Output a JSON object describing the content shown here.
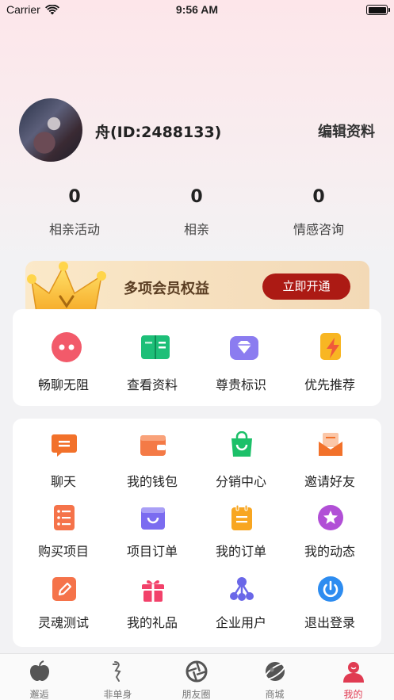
{
  "status_bar": {
    "carrier": "Carrier",
    "time": "9:56 AM"
  },
  "profile": {
    "username": "舟(ID:2488133)",
    "edit_label": "编辑资料"
  },
  "stats": [
    {
      "value": "0",
      "label": "相亲活动"
    },
    {
      "value": "0",
      "label": "相亲"
    },
    {
      "value": "0",
      "label": "情感咨询"
    }
  ],
  "vip": {
    "title": "多项会员权益",
    "button": "立即开通"
  },
  "benefits": [
    {
      "label": "畅聊无阻",
      "icon": "chat-bubble-icon"
    },
    {
      "label": "查看资料",
      "icon": "open-book-icon"
    },
    {
      "label": "尊贵标识",
      "icon": "diamond-icon"
    },
    {
      "label": "优先推荐",
      "icon": "lightning-icon"
    }
  ],
  "menu": [
    {
      "label": "聊天",
      "icon": "chat-icon"
    },
    {
      "label": "我的钱包",
      "icon": "wallet-icon"
    },
    {
      "label": "分销中心",
      "icon": "shopping-bag-icon"
    },
    {
      "label": "邀请好友",
      "icon": "invite-mail-icon"
    },
    {
      "label": "购买项目",
      "icon": "list-icon"
    },
    {
      "label": "项目订单",
      "icon": "basket-icon"
    },
    {
      "label": "我的订单",
      "icon": "clipboard-icon"
    },
    {
      "label": "我的动态",
      "icon": "star-icon"
    },
    {
      "label": "灵魂测试",
      "icon": "pencil-icon"
    },
    {
      "label": "我的礼品",
      "icon": "gift-icon"
    },
    {
      "label": "企业用户",
      "icon": "org-icon"
    },
    {
      "label": "退出登录",
      "icon": "power-icon"
    }
  ],
  "tabbar": [
    {
      "label": "邂逅",
      "icon": "apple-icon",
      "active": false
    },
    {
      "label": "非单身",
      "icon": "cupid-icon",
      "active": false
    },
    {
      "label": "朋友圈",
      "icon": "aperture-icon",
      "active": false
    },
    {
      "label": "商城",
      "icon": "planet-icon",
      "active": false
    },
    {
      "label": "我的",
      "icon": "user-icon",
      "active": true
    }
  ],
  "colors": {
    "accent": "#e03b52",
    "vip_button": "#ac1a14"
  }
}
